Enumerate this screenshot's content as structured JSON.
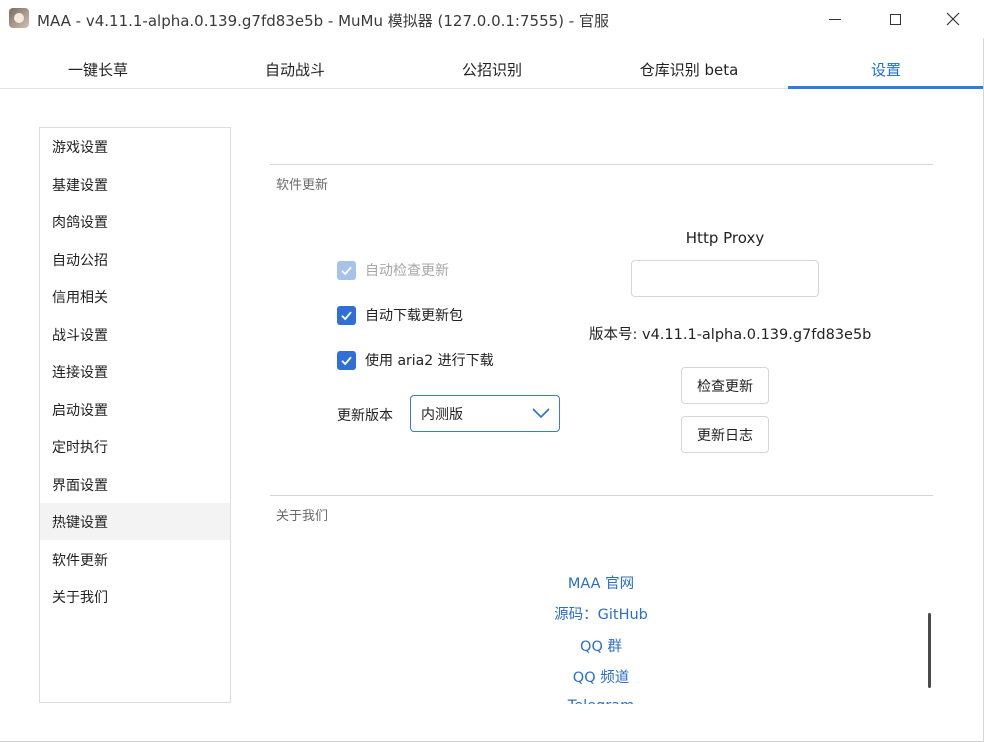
{
  "window": {
    "title": "MAA - v4.11.1-alpha.0.139.g7fd83e5b - MuMu 模拟器 (127.0.0.1:7555) - 官服"
  },
  "tabs": [
    {
      "label": "一键长草"
    },
    {
      "label": "自动战斗"
    },
    {
      "label": "公招识别"
    },
    {
      "label": "仓库识别 beta"
    },
    {
      "label": "设置"
    }
  ],
  "sidebar": {
    "items": [
      {
        "label": "游戏设置"
      },
      {
        "label": "基建设置"
      },
      {
        "label": "肉鸽设置"
      },
      {
        "label": "自动公招"
      },
      {
        "label": "信用相关"
      },
      {
        "label": "战斗设置"
      },
      {
        "label": "连接设置"
      },
      {
        "label": "启动设置"
      },
      {
        "label": "定时执行"
      },
      {
        "label": "界面设置"
      },
      {
        "label": "热键设置"
      },
      {
        "label": "软件更新"
      },
      {
        "label": "关于我们"
      }
    ]
  },
  "update": {
    "section_title": "软件更新",
    "auto_check_label": "自动检查更新",
    "auto_download_label": "自动下载更新包",
    "use_aria2_label": "使用 aria2 进行下载",
    "version_type_label": "更新版本",
    "version_type_value": "内测版",
    "proxy_label": "Http Proxy",
    "proxy_value": "",
    "version_text": "版本号: v4.11.1-alpha.0.139.g7fd83e5b",
    "check_button": "检查更新",
    "changelog_button": "更新日志"
  },
  "about": {
    "section_title": "关于我们",
    "links": [
      {
        "label": "MAA 官网"
      },
      {
        "label": "源码：GitHub"
      },
      {
        "label": "QQ 群"
      },
      {
        "label": "QQ 频道"
      },
      {
        "label": "Telegram"
      }
    ]
  },
  "colors": {
    "accent": "#2f7be0",
    "link": "#2a6fc9",
    "checkbox": "#2f6fd6",
    "checkbox_disabled": "#a8c2ea"
  },
  "icons": [
    "app-icon",
    "minimize-icon",
    "maximize-icon",
    "close-icon",
    "check-icon",
    "chevron-down-icon"
  ]
}
